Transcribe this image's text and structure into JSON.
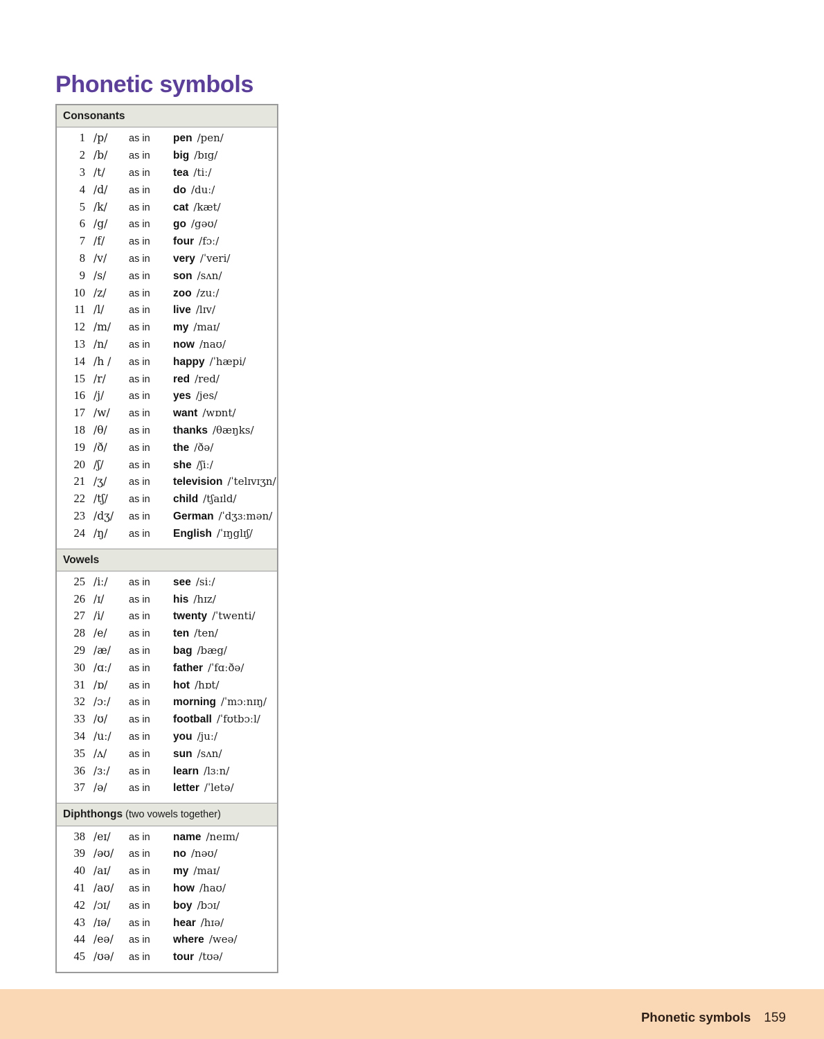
{
  "page": {
    "title": "Phonetic symbols",
    "title_color": "#5b3f99",
    "background_color": "#ffffff"
  },
  "footer": {
    "label": "Phonetic symbols",
    "page_number": "159",
    "band_color": "#fad8b6"
  },
  "table": {
    "header_color": "#e5e7de",
    "border_color": "#9a9a9a",
    "as_in_label": "as in",
    "sections": [
      {
        "title": "Consonants",
        "note": "",
        "rows": [
          {
            "num": "1",
            "symbol": "/p/",
            "as_in": "as in",
            "word": "pen",
            "ipa": "/pen/"
          },
          {
            "num": "2",
            "symbol": "/b/",
            "as_in": "as in",
            "word": "big",
            "ipa": "/bɪg/"
          },
          {
            "num": "3",
            "symbol": "/t/",
            "as_in": "as in",
            "word": "tea",
            "ipa": "/tiː/"
          },
          {
            "num": "4",
            "symbol": "/d/",
            "as_in": "as in",
            "word": "do",
            "ipa": "/duː/"
          },
          {
            "num": "5",
            "symbol": "/k/",
            "as_in": "as in",
            "word": "cat",
            "ipa": "/kæt/"
          },
          {
            "num": "6",
            "symbol": "/g/",
            "as_in": "as in",
            "word": "go",
            "ipa": "/gəʊ/"
          },
          {
            "num": "7",
            "symbol": "/f/",
            "as_in": "as in",
            "word": "four",
            "ipa": "/fɔː/"
          },
          {
            "num": "8",
            "symbol": "/v/",
            "as_in": "as in",
            "word": "very",
            "ipa": "/ˈveri/"
          },
          {
            "num": "9",
            "symbol": "/s/",
            "as_in": "as in",
            "word": "son",
            "ipa": "/sʌn/"
          },
          {
            "num": "10",
            "symbol": "/z/",
            "as_in": "as in",
            "word": "zoo",
            "ipa": "/zuː/"
          },
          {
            "num": "11",
            "symbol": "/l/",
            "as_in": "as in",
            "word": "live",
            "ipa": "/lɪv/"
          },
          {
            "num": "12",
            "symbol": "/m/",
            "as_in": "as in",
            "word": "my",
            "ipa": "/maɪ/"
          },
          {
            "num": "13",
            "symbol": "/n/",
            "as_in": "as in",
            "word": "now",
            "ipa": "/naʊ/"
          },
          {
            "num": "14",
            "symbol": "/h /",
            "as_in": "as in",
            "word": "happy",
            "ipa": "/ˈhæpi/"
          },
          {
            "num": "15",
            "symbol": "/r/",
            "as_in": "as in",
            "word": "red",
            "ipa": "/red/"
          },
          {
            "num": "16",
            "symbol": "/j/",
            "as_in": "as in",
            "word": "yes",
            "ipa": "/jes/"
          },
          {
            "num": "17",
            "symbol": "/w/",
            "as_in": "as in",
            "word": "want",
            "ipa": "/wɒnt/"
          },
          {
            "num": "18",
            "symbol": "/θ/",
            "as_in": "as in",
            "word": "thanks",
            "ipa": "/θæŋks/"
          },
          {
            "num": "19",
            "symbol": "/ð/",
            "as_in": "as in",
            "word": "the",
            "ipa": "/ðə/"
          },
          {
            "num": "20",
            "symbol": "/ʃ/",
            "as_in": "as in",
            "word": "she",
            "ipa": "/ʃiː/"
          },
          {
            "num": "21",
            "symbol": "/ʒ/",
            "as_in": "as in",
            "word": "television",
            "ipa": "/ˈtelɪvɪʒn/"
          },
          {
            "num": "22",
            "symbol": "/tʃ/",
            "as_in": "as in",
            "word": "child",
            "ipa": "/tʃaɪld/"
          },
          {
            "num": "23",
            "symbol": "/dʒ/",
            "as_in": "as in",
            "word": "German",
            "ipa": "/ˈdʒɜːmən/"
          },
          {
            "num": "24",
            "symbol": "/ŋ/",
            "as_in": "as in",
            "word": "English",
            "ipa": "/ˈɪŋglɪʃ/"
          }
        ]
      },
      {
        "title": "Vowels",
        "note": "",
        "rows": [
          {
            "num": "25",
            "symbol": "/iː/",
            "as_in": "as in",
            "word": "see",
            "ipa": "/siː/"
          },
          {
            "num": "26",
            "symbol": "/ɪ/",
            "as_in": "as in",
            "word": "his",
            "ipa": "/hɪz/"
          },
          {
            "num": "27",
            "symbol": "/i/",
            "as_in": "as in",
            "word": "twenty",
            "ipa": "/ˈtwenti/"
          },
          {
            "num": "28",
            "symbol": "/e/",
            "as_in": "as in",
            "word": "ten",
            "ipa": "/ten/"
          },
          {
            "num": "29",
            "symbol": "/æ/",
            "as_in": "as in",
            "word": "bag",
            "ipa": "/bæg/"
          },
          {
            "num": "30",
            "symbol": "/ɑː/",
            "as_in": "as in",
            "word": "father",
            "ipa": "/ˈfɑːðə/"
          },
          {
            "num": "31",
            "symbol": "/ɒ/",
            "as_in": "as in",
            "word": "hot",
            "ipa": "/hɒt/"
          },
          {
            "num": "32",
            "symbol": "/ɔː/",
            "as_in": "as in",
            "word": "morning",
            "ipa": "/ˈmɔːnɪŋ/"
          },
          {
            "num": "33",
            "symbol": "/ʊ/",
            "as_in": "as in",
            "word": "football",
            "ipa": "/ˈfʊtbɔːl/"
          },
          {
            "num": "34",
            "symbol": "/uː/",
            "as_in": "as in",
            "word": "you",
            "ipa": "/juː/"
          },
          {
            "num": "35",
            "symbol": "/ʌ/",
            "as_in": "as in",
            "word": "sun",
            "ipa": "/sʌn/"
          },
          {
            "num": "36",
            "symbol": "/ɜː/",
            "as_in": "as in",
            "word": "learn",
            "ipa": "/lɜːn/"
          },
          {
            "num": "37",
            "symbol": "/ə/",
            "as_in": "as in",
            "word": "letter",
            "ipa": "/ˈletə/"
          }
        ]
      },
      {
        "title": "Diphthongs",
        "note": " (two vowels together)",
        "rows": [
          {
            "num": "38",
            "symbol": "/eɪ/",
            "as_in": "as in",
            "word": "name",
            "ipa": "/neɪm/"
          },
          {
            "num": "39",
            "symbol": "/əʊ/",
            "as_in": "as in",
            "word": "no",
            "ipa": "/nəʊ/"
          },
          {
            "num": "40",
            "symbol": "/aɪ/",
            "as_in": "as in",
            "word": "my",
            "ipa": "/maɪ/"
          },
          {
            "num": "41",
            "symbol": "/aʊ/",
            "as_in": "as in",
            "word": "how",
            "ipa": "/haʊ/"
          },
          {
            "num": "42",
            "symbol": "/ɔɪ/",
            "as_in": "as in",
            "word": "boy",
            "ipa": "/bɔɪ/"
          },
          {
            "num": "43",
            "symbol": "/ɪə/",
            "as_in": "as in",
            "word": "hear",
            "ipa": "/hɪə/"
          },
          {
            "num": "44",
            "symbol": "/eə/",
            "as_in": "as in",
            "word": "where",
            "ipa": "/weə/"
          },
          {
            "num": "45",
            "symbol": "/ʊə/",
            "as_in": "as in",
            "word": "tour",
            "ipa": "/tʊə/"
          }
        ]
      }
    ]
  }
}
